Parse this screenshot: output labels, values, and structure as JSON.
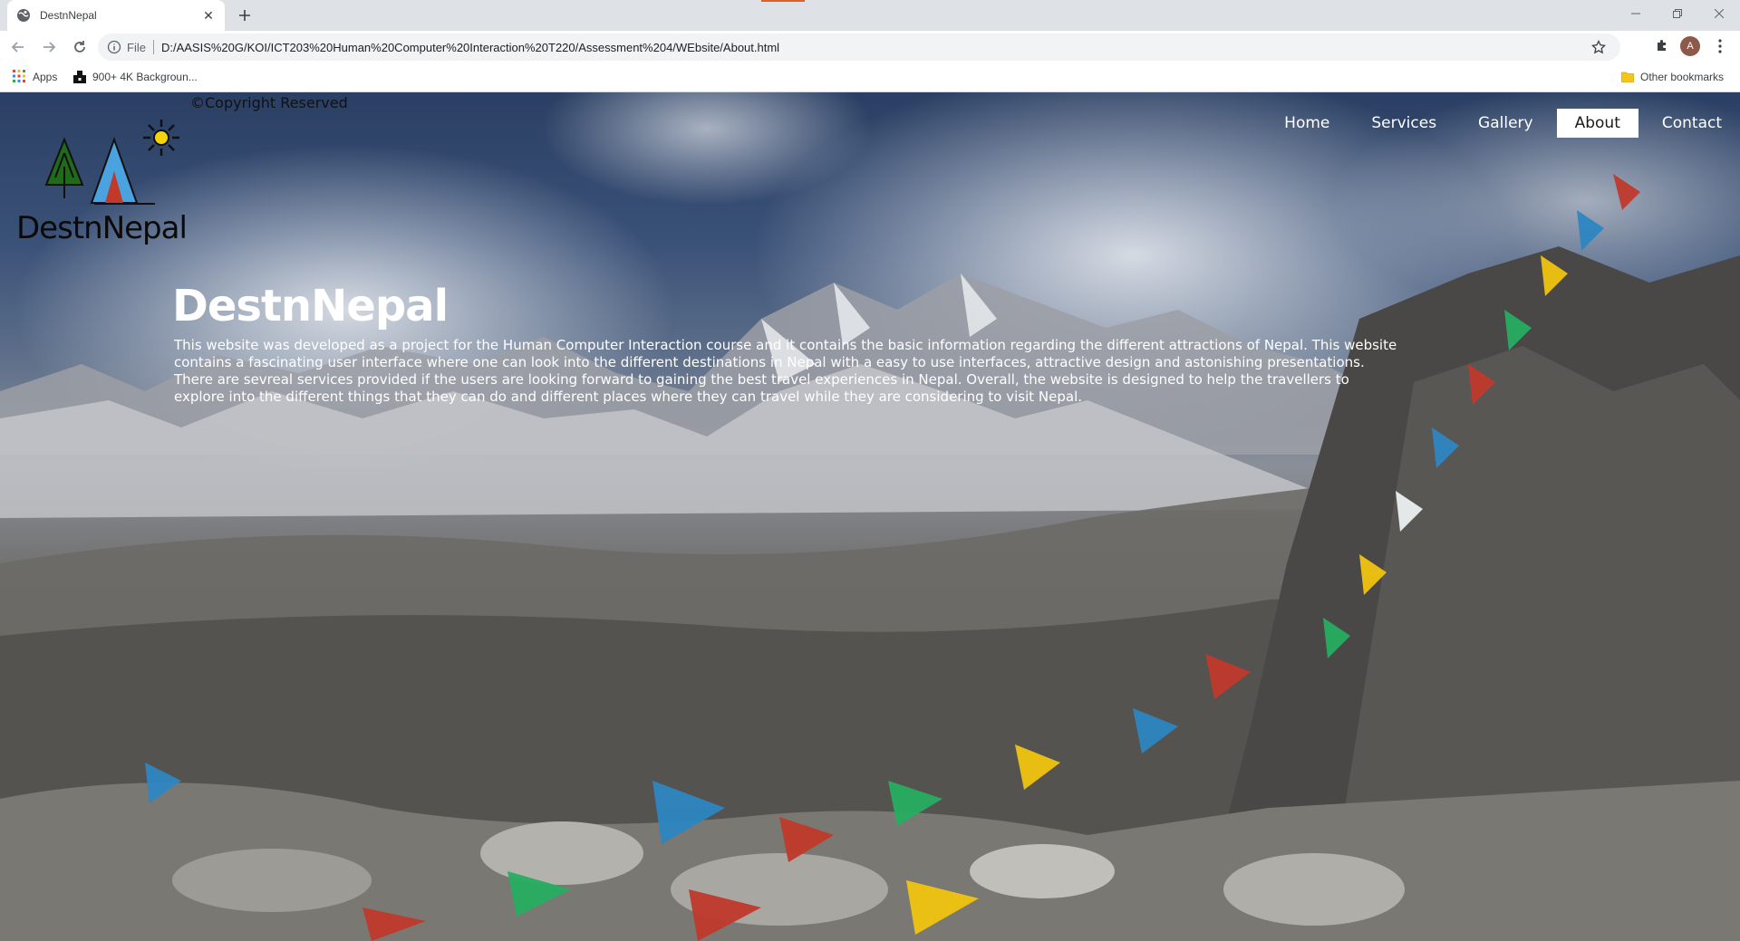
{
  "browser": {
    "tab_title": "DestnNepal",
    "tab_favicon": "globe-icon",
    "scheme_label": "File",
    "url": "D:/AASIS%20G/KOI/ICT203%20Human%20Computer%20Interaction%20T220/Assessment%204/WEbsite/About.html",
    "profile_initial": "A",
    "accent_color": "#d9622b",
    "bookmarks": {
      "apps_label": "Apps",
      "bookmark1_label": "900+ 4K Backgroun...",
      "other_label": "Other bookmarks"
    }
  },
  "page": {
    "copyright": "©Copyright Reserved",
    "logo_text": "DestnNepal",
    "nav": {
      "home": "Home",
      "services": "Services",
      "gallery": "Gallery",
      "about": "About",
      "contact": "Contact",
      "active": "About"
    },
    "hero": {
      "title": "DestnNepal",
      "body": "This website was developed as a project for the Human Computer Interaction course and it contains the basic information regarding the different attractions of Nepal. This website contains a fascinating user interface where one can look into the different destinations in Nepal with a easy to use interfaces, attractive design and astonishing presentations. There are sevreal services provided if the users are looking forward to gaining the best travel experiences in Nepal. Overall, the website is designed to help the travellers to explore into the different things that they can do and different places where they can travel while they are considering to visit Nepal."
    },
    "colors": {
      "nav_active_bg": "#ffffff",
      "text": "#ffffff"
    }
  }
}
